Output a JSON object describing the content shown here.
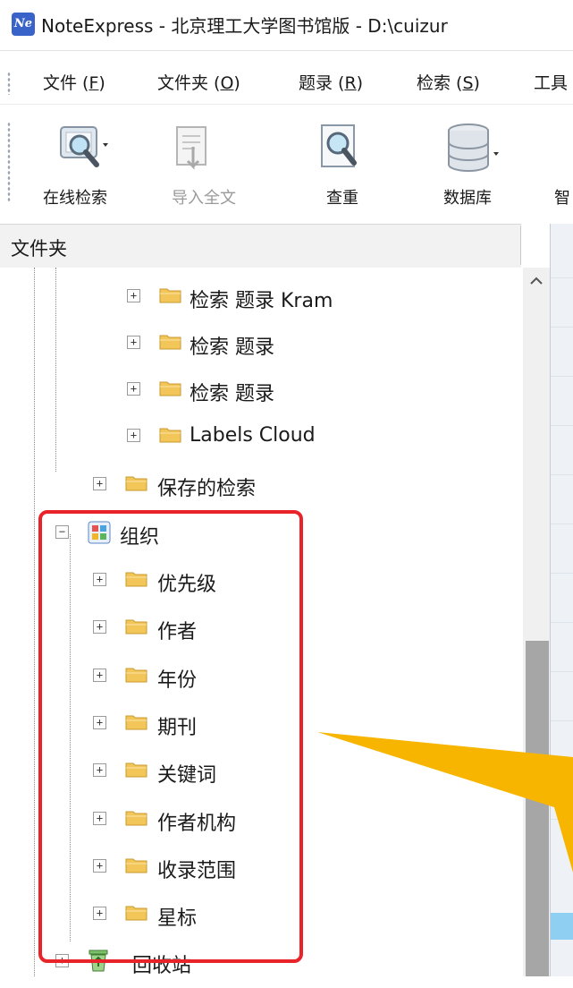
{
  "window": {
    "title": "NoteExpress - 北京理工大学图书馆版 - D:\\cuizur",
    "logo_text": "Ne"
  },
  "menu": [
    {
      "label": "文件 (",
      "key": "F",
      "tail": ")"
    },
    {
      "label": "文件夹 (",
      "key": "O",
      "tail": ")"
    },
    {
      "label": "题录 (",
      "key": "R",
      "tail": ")"
    },
    {
      "label": "检索 (",
      "key": "S",
      "tail": ")"
    },
    {
      "label": "工具",
      "key": "",
      "tail": ""
    }
  ],
  "toolbar": {
    "online_search": "在线检索",
    "import_fulltext": "导入全文",
    "dedupe": "查重",
    "database": "数据库",
    "next_partial": "智"
  },
  "folder_pane": {
    "header": "文件夹"
  },
  "tree": {
    "items": [
      {
        "label": "检索 题录 Kram",
        "icon": "folder-icon"
      },
      {
        "label": "检索 题录",
        "icon": "folder-icon"
      },
      {
        "label": "检索 题录",
        "icon": "folder-icon"
      },
      {
        "label": "Labels Cloud",
        "icon": "folder-icon"
      },
      {
        "label": "保存的检索",
        "icon": "folder-icon"
      },
      {
        "label": "组织",
        "icon": "organize-icon"
      },
      {
        "label": "优先级",
        "icon": "folder-icon"
      },
      {
        "label": "作者",
        "icon": "folder-icon"
      },
      {
        "label": "年份",
        "icon": "folder-icon"
      },
      {
        "label": "期刊",
        "icon": "folder-icon"
      },
      {
        "label": "关键词",
        "icon": "folder-icon"
      },
      {
        "label": "作者机构",
        "icon": "folder-icon"
      },
      {
        "label": "收录范围",
        "icon": "folder-icon"
      },
      {
        "label": "星标",
        "icon": "folder-icon"
      },
      {
        "label": "回收站",
        "icon": "recycle-bin-icon"
      }
    ]
  },
  "colors": {
    "highlight_box": "#e8242a",
    "arrow": "#f7b500",
    "folder": "#f2c14e"
  }
}
